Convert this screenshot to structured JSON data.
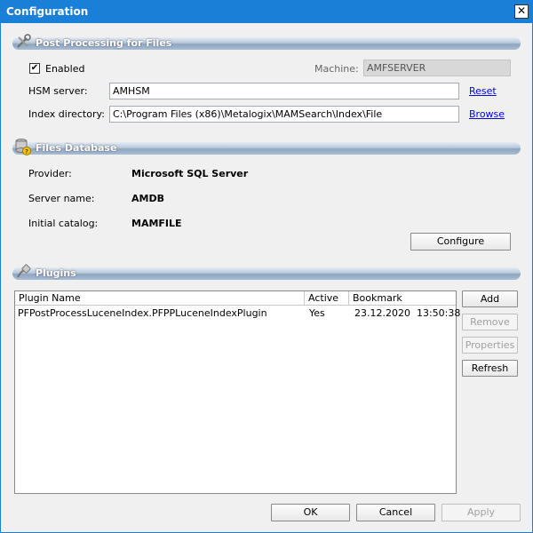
{
  "window": {
    "title": "Configuration",
    "close_glyph": "✕"
  },
  "post_processing": {
    "section_title": "Post Processing for Files",
    "icon": "tools-icon",
    "enabled_label": "Enabled",
    "enabled_checked": true,
    "machine_label": "Machine:",
    "machine_value": "AMFSERVER",
    "hsm_label": "HSM server:",
    "hsm_value": "AMHSM",
    "reset_link": "Reset",
    "index_label": "Index directory:",
    "index_value": "C:\\Program Files (x86)\\Metalogix\\MAMSearch\\Index\\File",
    "browse_link": "Browse"
  },
  "files_database": {
    "section_title": "Files Database",
    "icon": "database-icon",
    "provider_label": "Provider:",
    "provider_value": "Microsoft SQL Server",
    "server_label": "Server name:",
    "server_value": "AMDB",
    "catalog_label": "Initial catalog:",
    "catalog_value": "MAMFILE",
    "configure_button": "Configure"
  },
  "plugins": {
    "section_title": "Plugins",
    "icon": "plug-icon",
    "columns": [
      "Plugin Name",
      "Active",
      "Bookmark"
    ],
    "rows": [
      {
        "name": "PFPostProcessLuceneIndex.PFPPLuceneIndexPlugin",
        "active": "Yes",
        "bookmark": "23.12.2020  13:50:38"
      }
    ],
    "buttons": {
      "add": "Add",
      "remove": "Remove",
      "properties": "Properties",
      "refresh": "Refresh"
    }
  },
  "footer": {
    "ok": "OK",
    "cancel": "Cancel",
    "apply": "Apply"
  }
}
